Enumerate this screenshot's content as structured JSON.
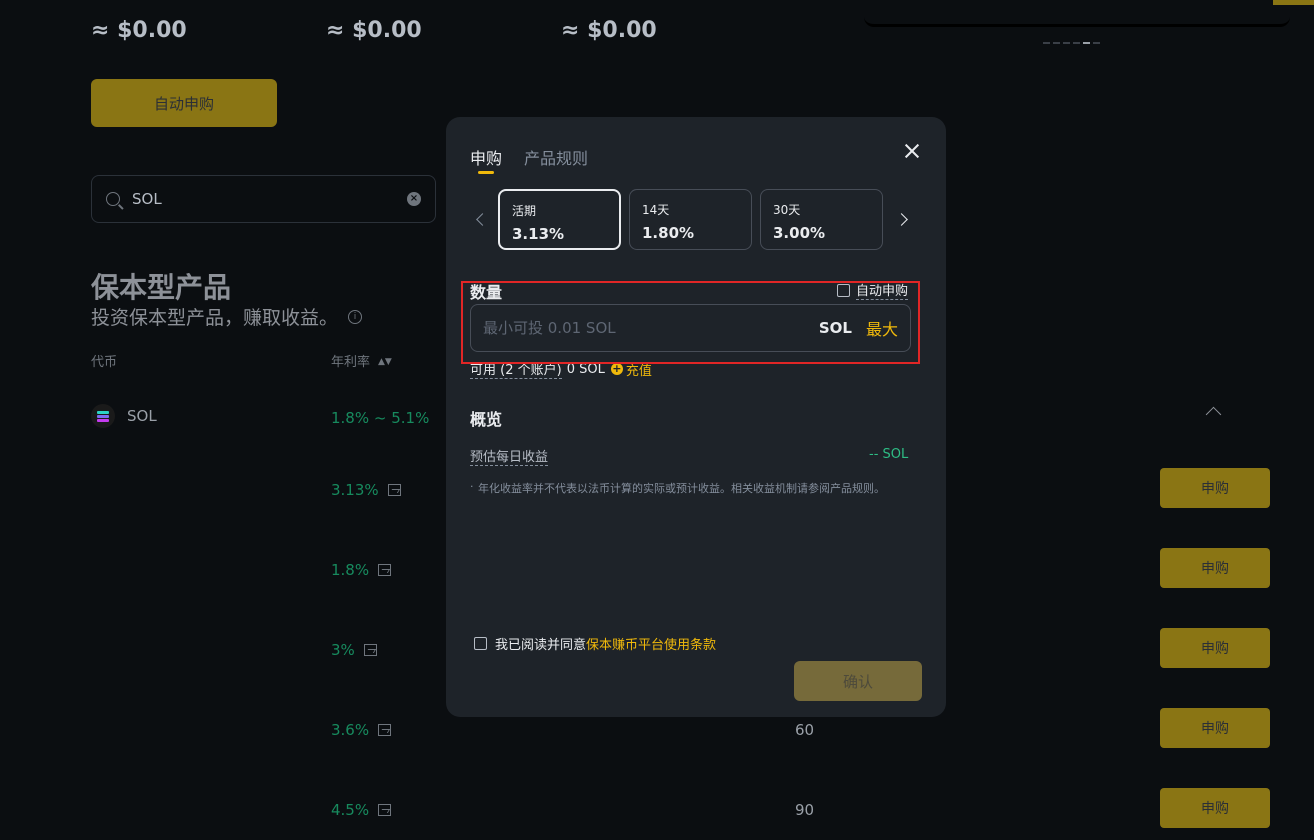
{
  "background": {
    "balances": [
      "≈ $0.00",
      "≈ $0.00",
      "≈ $0.00"
    ],
    "auto_subscribe_label": "自动申购",
    "search": {
      "value": "SOL",
      "clear_glyph": "×"
    },
    "section_title": "保本型产品",
    "section_subtitle": "投资保本型产品，赚取收益。",
    "info_glyph": "i",
    "columns": {
      "coin": "代币",
      "apr": "年利率",
      "sort_glyph": "▲▼"
    },
    "coin": {
      "name": "SOL",
      "apr_range": "1.8% ~ 5.1%"
    },
    "products": [
      {
        "apr": "3.13%",
        "days": "",
        "button": "申购"
      },
      {
        "apr": "1.8%",
        "days": "",
        "button": "申购"
      },
      {
        "apr": "3%",
        "days": "",
        "button": "申购"
      },
      {
        "apr": "3.6%",
        "days": "60",
        "button": "申购"
      },
      {
        "apr": "4.5%",
        "days": "90",
        "button": "申购"
      }
    ],
    "carousel_active_index": 4
  },
  "modal": {
    "tabs": [
      "申购",
      "产品规则"
    ],
    "active_tab": 0,
    "terms": [
      {
        "label": "活期",
        "rate": "3.13%",
        "selected": true
      },
      {
        "label": "14天",
        "rate": "1.80%",
        "selected": false
      },
      {
        "label": "30天",
        "rate": "3.00%",
        "selected": false
      }
    ],
    "amount": {
      "label": "数量",
      "auto_subscribe": "自动申购",
      "placeholder": "最小可投 0.01 SOL",
      "value": "",
      "unit": "SOL",
      "max": "最大"
    },
    "available": {
      "label": "可用 (2 个账户)",
      "value": "0 SOL",
      "plus_glyph": "+",
      "recharge": "充值"
    },
    "overview": {
      "title": "概览",
      "est_daily_label": "预估每日收益",
      "est_daily_value": "-- SOL",
      "note": "年化收益率并不代表以法币计算的实际或预计收益。相关收益机制请参阅产品规则。"
    },
    "agree": {
      "text": "我已阅读并同意",
      "link": "保本赚币平台使用条款"
    },
    "confirm": "确认"
  },
  "colors": {
    "accent": "#f0b90b",
    "positive": "#2ebd85",
    "highlight_border": "#e12626",
    "modal_bg": "#1e2329",
    "page_bg": "#0b0e11"
  }
}
